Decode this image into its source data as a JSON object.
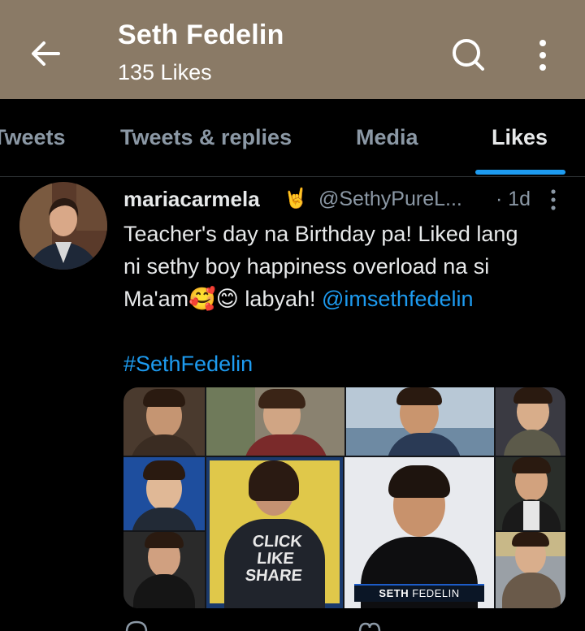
{
  "header": {
    "title": "Seth Fedelin",
    "subtitle": "135 Likes",
    "background": "#8a7a66",
    "back_icon": "arrow-left-icon",
    "search_icon": "search-icon",
    "more_icon": "more-vertical-icon"
  },
  "tabs": [
    {
      "label": "Tweets",
      "active": false
    },
    {
      "label": "Tweets & replies",
      "active": false
    },
    {
      "label": "Media",
      "active": false
    },
    {
      "label": "Likes",
      "active": true
    }
  ],
  "accent_color": "#1d9bf0",
  "tweet": {
    "author_name": "mariacarmela",
    "author_emoji": "🤘",
    "handle": "@SethyPureL...",
    "time": "· 1d",
    "text_line1": "Teacher's day na Birthday pa! Liked lang",
    "text_line2": "ni sethy boy happiness overload na si",
    "text_line3_prefix": "Ma'am🥰😊 labyah! ",
    "mention": "@imsethfedelin",
    "hashtag": "#SethFedelin",
    "media_caption_first": "SETH",
    "media_caption_last": " FEDELIN",
    "shirt_line1": "CLICK",
    "shirt_line2": "LIKE",
    "shirt_line3": "SHARE"
  }
}
